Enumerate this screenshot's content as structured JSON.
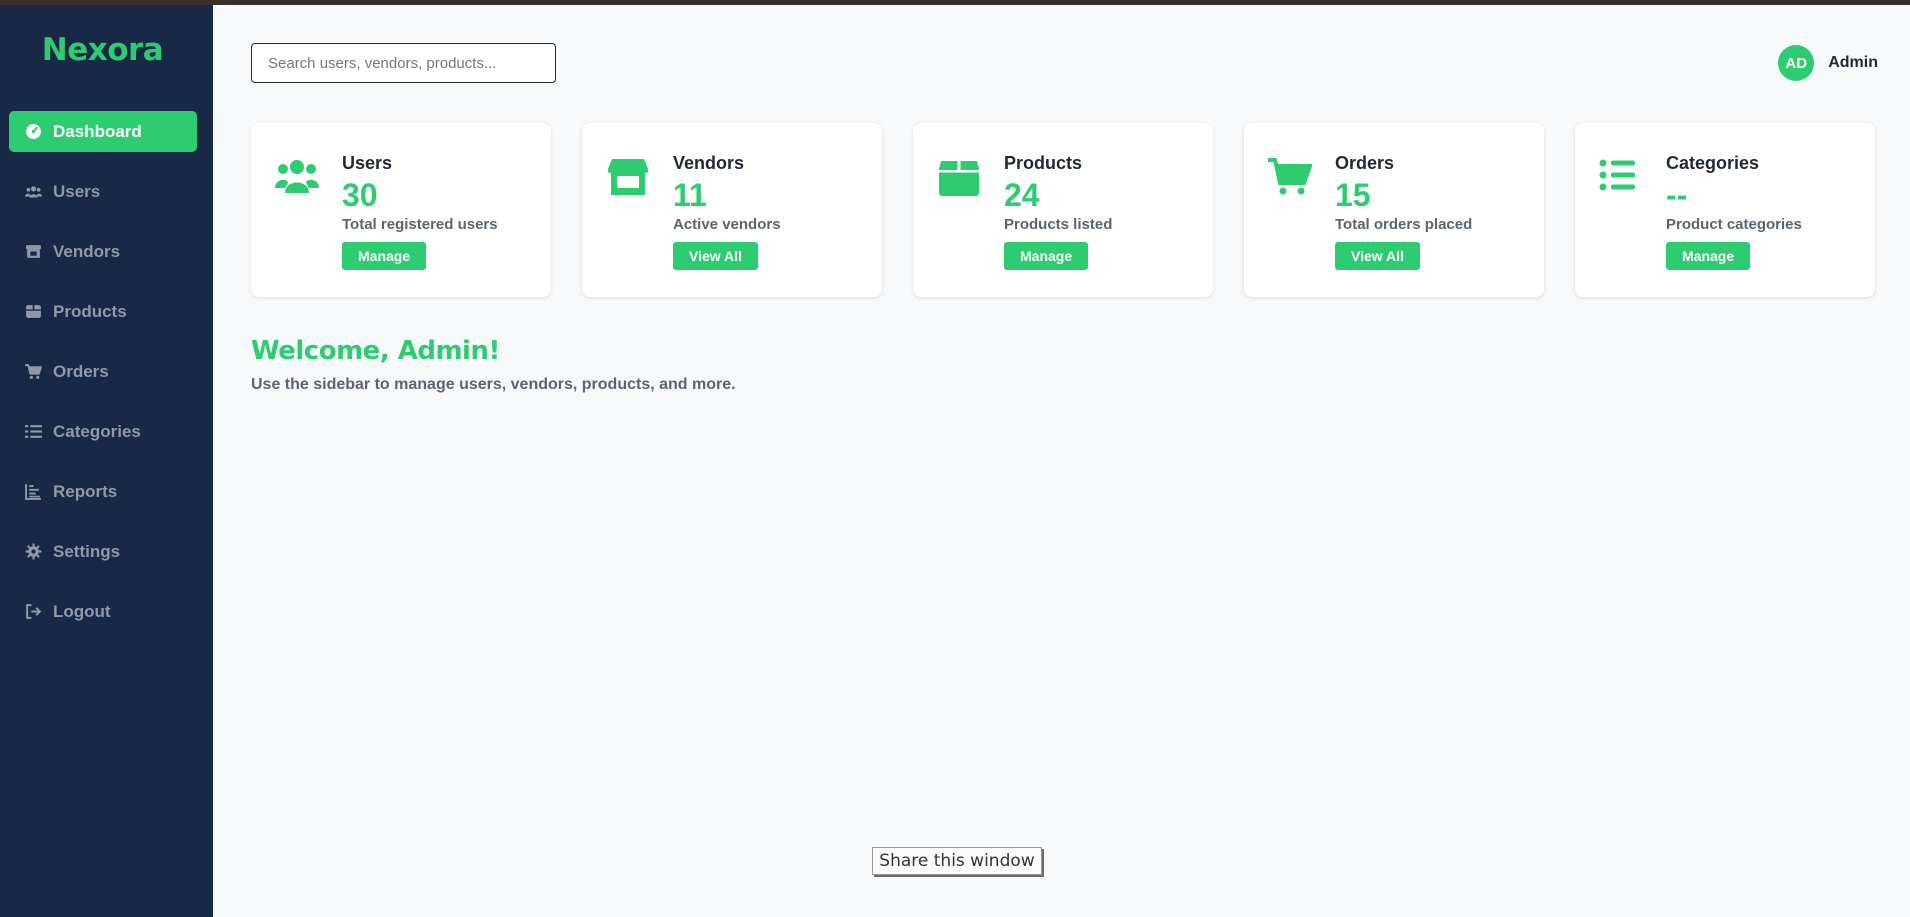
{
  "brand": "Nexora",
  "sidebar": {
    "items": [
      {
        "label": "Dashboard",
        "icon": "dashboard-icon",
        "active": true
      },
      {
        "label": "Users",
        "icon": "users-icon"
      },
      {
        "label": "Vendors",
        "icon": "store-icon"
      },
      {
        "label": "Products",
        "icon": "box-icon"
      },
      {
        "label": "Orders",
        "icon": "cart-icon"
      },
      {
        "label": "Categories",
        "icon": "list-icon"
      },
      {
        "label": "Reports",
        "icon": "chart-icon"
      },
      {
        "label": "Settings",
        "icon": "gear-icon"
      },
      {
        "label": "Logout",
        "icon": "logout-icon"
      }
    ]
  },
  "header": {
    "search_placeholder": "Search users, vendors, products...",
    "avatar_initials": "AD",
    "user_name": "Admin"
  },
  "cards": [
    {
      "title": "Users",
      "value": "30",
      "desc": "Total registered users",
      "button": "Manage",
      "icon": "users-icon"
    },
    {
      "title": "Vendors",
      "value": "11",
      "desc": "Active vendors",
      "button": "View All",
      "icon": "store-icon"
    },
    {
      "title": "Products",
      "value": "24",
      "desc": "Products listed",
      "button": "Manage",
      "icon": "box-icon"
    },
    {
      "title": "Orders",
      "value": "15",
      "desc": "Total orders placed",
      "button": "View All",
      "icon": "cart-icon"
    },
    {
      "title": "Categories",
      "value": "--",
      "desc": "Product categories",
      "button": "Manage",
      "icon": "list-icon"
    }
  ],
  "welcome": {
    "title": "Welcome, Admin!",
    "subtitle": "Use the sidebar to manage users, vendors, products, and more."
  },
  "share_button": "Share this window",
  "colors": {
    "sidebar_bg": "#172947",
    "accent": "#2ecc71",
    "page_bg": "#f8f9fb"
  }
}
